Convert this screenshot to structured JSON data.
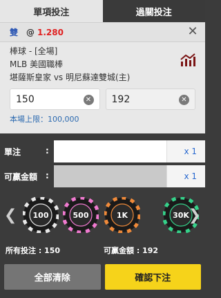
{
  "tabs": [
    {
      "label": "單項投注"
    },
    {
      "label": "過關投注"
    }
  ],
  "bet": {
    "selection": "雙",
    "at": "@",
    "odds": "1.280",
    "sport": "棒球 - [全場]",
    "league": "MLB 美國職棒",
    "match": "堪薩斯皇家 vs 明尼蘇達雙城(主)",
    "stake_value": "150",
    "payout_value": "192",
    "limit": "本場上限：100,000"
  },
  "stake_rows": [
    {
      "label": "單注",
      "colon": ":",
      "multiplier": "x 1"
    },
    {
      "label": "可贏金額",
      "colon": ":",
      "multiplier": "x 1"
    }
  ],
  "chips": [
    {
      "label": "100",
      "color": "#ffffff"
    },
    {
      "label": "500",
      "color": "#f07ad0"
    },
    {
      "label": "1K",
      "color": "#f08a3a"
    },
    {
      "label": "30K",
      "color": "#35d28a"
    }
  ],
  "totals": {
    "all_bets": "所有投注 : 150",
    "payout": "可贏金額 : 192"
  },
  "buttons": {
    "clear": "全部清除",
    "confirm": "確認下注"
  },
  "colors": {
    "accent_yellow": "#f6d31a",
    "odds_red": "#e02020",
    "link_blue": "#2a6ad0"
  }
}
